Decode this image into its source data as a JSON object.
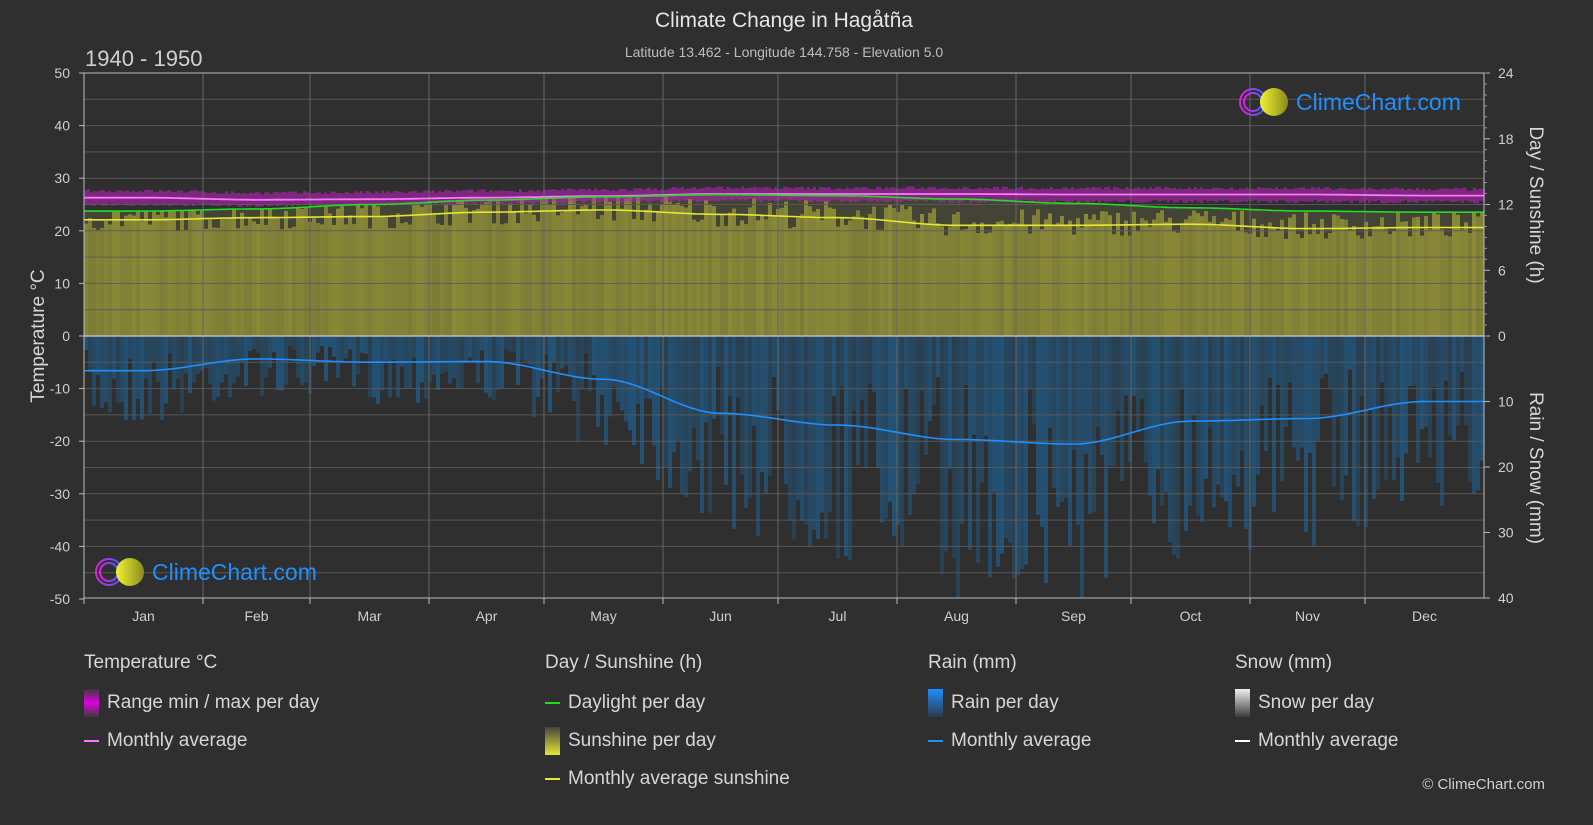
{
  "header": {
    "title": "Climate Change in Hagåtña",
    "subtitle": "Latitude 13.462 - Longitude 144.758 - Elevation 5.0",
    "period": "1940 - 1950"
  },
  "logo": {
    "text": "ClimeChart.com"
  },
  "copyright": "© ClimeChart.com",
  "colors": {
    "background": "#2f2f2f",
    "temp_range": "#c020c0",
    "temp_avg": "#ff77ff",
    "daylight": "#22dd22",
    "sunshine_fill": "#8a8a38",
    "sunshine_avg": "#e6e633",
    "rain_fill": "#1f5f8f",
    "rain_avg": "#1e90ff",
    "snow_avg": "#ffffff"
  },
  "legend": [
    {
      "title": "Temperature °C",
      "items": [
        {
          "label": "Range min / max per day",
          "swatch": "box",
          "color": "#e000e0"
        },
        {
          "label": "Monthly average",
          "swatch": "line",
          "color": "#ff77ff"
        }
      ]
    },
    {
      "title": "Day / Sunshine (h)",
      "items": [
        {
          "label": "Daylight per day",
          "swatch": "line",
          "color": "#22dd22"
        },
        {
          "label": "Sunshine per day",
          "swatch": "box",
          "color": "#e6e633"
        },
        {
          "label": "Monthly average sunshine",
          "swatch": "line",
          "color": "#e6e633"
        }
      ]
    },
    {
      "title": "Rain (mm)",
      "items": [
        {
          "label": "Rain per day",
          "swatch": "box",
          "color": "#1e8fff"
        },
        {
          "label": "Monthly average",
          "swatch": "line",
          "color": "#1e90ff"
        }
      ]
    },
    {
      "title": "Snow (mm)",
      "items": [
        {
          "label": "Snow per day",
          "swatch": "box",
          "color": "#e0e0e0"
        },
        {
          "label": "Monthly average",
          "swatch": "line",
          "color": "#ffffff"
        }
      ]
    }
  ],
  "chart_data": {
    "type": "area",
    "title": "Climate Change in Hagåtña",
    "subtitle": "Latitude 13.462 - Longitude 144.758 - Elevation 5.0",
    "categories": [
      "Jan",
      "Feb",
      "Mar",
      "Apr",
      "May",
      "Jun",
      "Jul",
      "Aug",
      "Sep",
      "Oct",
      "Nov",
      "Dec"
    ],
    "left_axis": {
      "label": "Temperature °C",
      "range": [
        -50,
        50
      ],
      "ticks": [
        50,
        40,
        30,
        20,
        10,
        0,
        -10,
        -20,
        -30,
        -40,
        -50
      ]
    },
    "right_axis_top": {
      "label": "Day / Sunshine (h)",
      "range": [
        0,
        24
      ],
      "ticks": [
        24,
        18,
        12,
        6,
        0
      ]
    },
    "right_axis_bottom": {
      "label": "Rain / Snow (mm)",
      "range": [
        0,
        40
      ],
      "ticks": [
        0,
        10,
        20,
        30,
        40
      ]
    },
    "grid": true,
    "legend_position": "bottom",
    "series": [
      {
        "name": "Temperature monthly average (°C)",
        "axis": "left",
        "values": [
          26.3,
          25.9,
          26.0,
          26.3,
          26.6,
          27.0,
          27.0,
          27.0,
          26.9,
          26.9,
          26.9,
          26.7
        ]
      },
      {
        "name": "Temperature range min (°C)",
        "axis": "left",
        "values": [
          25.0,
          24.8,
          24.9,
          25.2,
          25.5,
          25.8,
          25.7,
          25.6,
          25.5,
          25.6,
          25.6,
          25.5
        ]
      },
      {
        "name": "Temperature range max (°C)",
        "axis": "left",
        "values": [
          27.6,
          27.2,
          27.3,
          27.6,
          27.8,
          28.2,
          28.1,
          28.2,
          28.1,
          28.1,
          28.1,
          27.9
        ]
      },
      {
        "name": "Daylight per day (h)",
        "axis": "right_top",
        "values": [
          11.4,
          11.6,
          12.0,
          12.4,
          12.7,
          12.9,
          12.8,
          12.5,
          12.1,
          11.7,
          11.4,
          11.3
        ]
      },
      {
        "name": "Monthly average sunshine (h)",
        "axis": "right_top",
        "values": [
          10.6,
          10.8,
          10.9,
          11.3,
          11.5,
          11.1,
          10.8,
          10.1,
          10.1,
          10.2,
          9.8,
          9.9
        ]
      },
      {
        "name": "Rain monthly average (mm)",
        "axis": "right_bottom",
        "values": [
          5.3,
          3.5,
          4.0,
          3.9,
          6.6,
          11.8,
          13.6,
          15.8,
          16.5,
          13.0,
          12.6,
          10.0
        ]
      },
      {
        "name": "Snow monthly average (mm)",
        "axis": "right_bottom",
        "values": [
          0,
          0,
          0,
          0,
          0,
          0,
          0,
          0,
          0,
          0,
          0,
          0
        ]
      }
    ]
  }
}
